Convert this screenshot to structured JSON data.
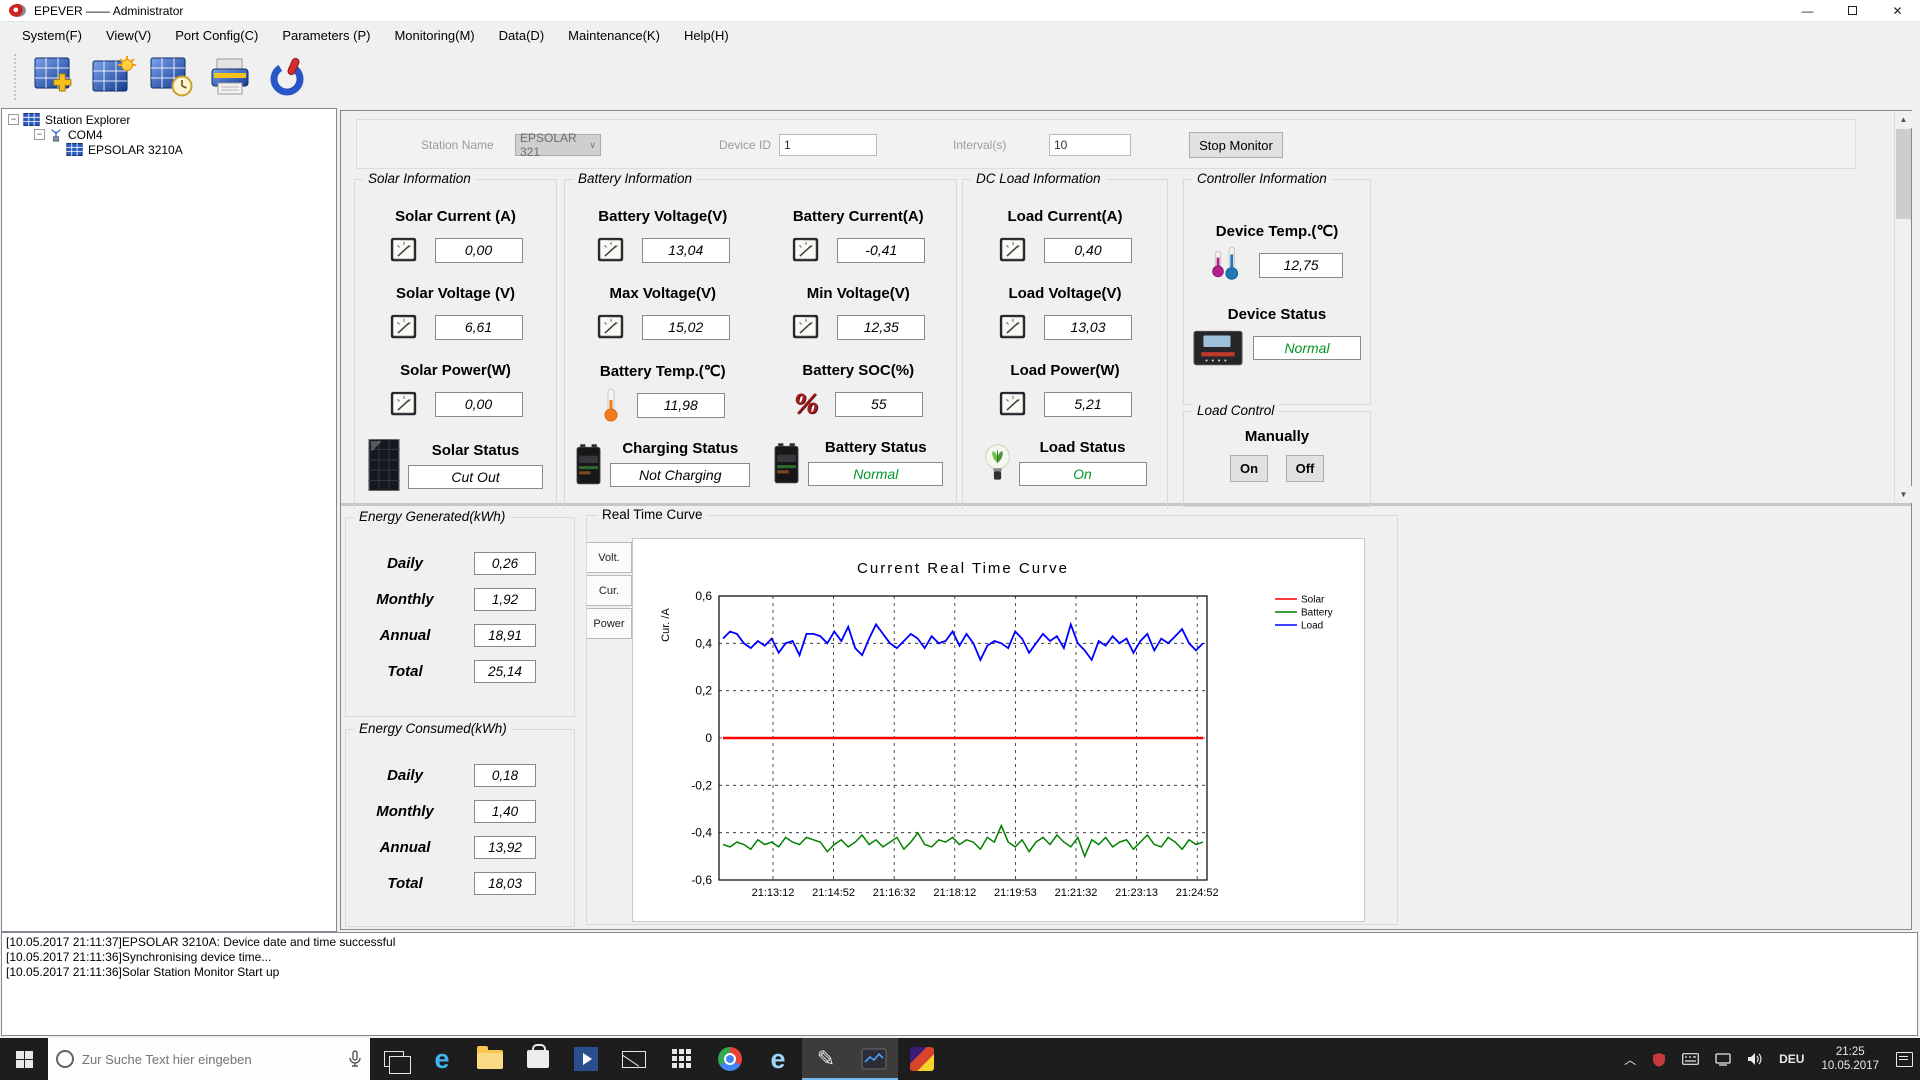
{
  "window": {
    "title": "EPEVER —— Administrator"
  },
  "menu": {
    "items": [
      "System(F)",
      "View(V)",
      "Port Config(C)",
      "Parameters (P)",
      "Monitoring(M)",
      "Data(D)",
      "Maintenance(K)",
      "Help(H)"
    ]
  },
  "toolbar": {
    "buttons": [
      "add-station",
      "station-monitor",
      "station-schedule",
      "print",
      "power"
    ]
  },
  "tree": {
    "root_label": "Station Explorer",
    "com_label": "COM4",
    "device_label": "EPSOLAR 3210A"
  },
  "station_bar": {
    "station_name_label": "Station Name",
    "station_name_value": "EPSOLAR 321",
    "device_id_label": "Device ID",
    "device_id_value": "1",
    "interval_label": "Interval(s)",
    "interval_value": "10",
    "stop_monitor_label": "Stop Monitor"
  },
  "solar": {
    "title": "Solar Information",
    "current_label": "Solar Current (A)",
    "current": "0,00",
    "voltage_label": "Solar Voltage (V)",
    "voltage": "6,61",
    "power_label": "Solar Power(W)",
    "power": "0,00",
    "status_label": "Solar Status",
    "status": "Cut Out"
  },
  "battery": {
    "title": "Battery Information",
    "voltage_label": "Battery Voltage(V)",
    "voltage": "13,04",
    "current_label": "Battery Current(A)",
    "current": "-0,41",
    "max_voltage_label": "Max Voltage(V)",
    "max_voltage": "15,02",
    "min_voltage_label": "Min Voltage(V)",
    "min_voltage": "12,35",
    "temp_label": "Battery Temp.(℃)",
    "temp": "11,98",
    "soc_label": "Battery SOC(%)",
    "soc": "55",
    "charging_status_label": "Charging Status",
    "charging_status": "Not Charging",
    "battery_status_label": "Battery Status",
    "battery_status": "Normal"
  },
  "load": {
    "title": "DC Load Information",
    "current_label": "Load Current(A)",
    "current": "0,40",
    "voltage_label": "Load Voltage(V)",
    "voltage": "13,03",
    "power_label": "Load Power(W)",
    "power": "5,21",
    "status_label": "Load Status",
    "status": "On"
  },
  "controller": {
    "title": "Controller Information",
    "temp_label": "Device Temp.(℃)",
    "temp": "12,75",
    "status_label": "Device Status",
    "status": "Normal"
  },
  "load_control": {
    "title": "Load Control",
    "manually_label": "Manually",
    "on_button": "On",
    "off_button": "Off"
  },
  "energy_generated": {
    "title": "Energy Generated(kWh)",
    "rows": [
      {
        "label": "Daily",
        "value": "0,26"
      },
      {
        "label": "Monthly",
        "value": "1,92"
      },
      {
        "label": "Annual",
        "value": "18,91"
      },
      {
        "label": "Total",
        "value": "25,14"
      }
    ]
  },
  "energy_consumed": {
    "title": "Energy Consumed(kWh)",
    "rows": [
      {
        "label": "Daily",
        "value": "0,18"
      },
      {
        "label": "Monthly",
        "value": "1,40"
      },
      {
        "label": "Annual",
        "value": "13,92"
      },
      {
        "label": "Total",
        "value": "18,03"
      }
    ]
  },
  "curve": {
    "group_title": "Real Time Curve",
    "tabs": [
      "Volt.",
      "Cur.",
      "Power"
    ]
  },
  "chart_data": {
    "type": "line",
    "title": "Current Real Time Curve",
    "xlabel": "",
    "ylabel": "Cur. /A",
    "ylim": [
      -0.6,
      0.6
    ],
    "grid": true,
    "legend_position": "right-top",
    "ytick_values": [
      0.6,
      0.4,
      0.2,
      0,
      -0.2,
      -0.4,
      -0.6
    ],
    "ytick_labels": [
      "0,6",
      "0,4",
      "0,2",
      "0",
      "-0,2",
      "-0,4",
      "-0,6"
    ],
    "x_labels": [
      "21:13:12",
      "21:14:52",
      "21:16:32",
      "21:18:12",
      "21:19:53",
      "21:21:32",
      "21:23:13",
      "21:24:52"
    ],
    "series": [
      {
        "name": "Solar",
        "color": "#ff0000",
        "values": [
          0,
          0,
          0,
          0,
          0,
          0,
          0,
          0,
          0,
          0,
          0,
          0,
          0,
          0,
          0,
          0,
          0,
          0,
          0,
          0,
          0,
          0,
          0,
          0,
          0,
          0,
          0,
          0,
          0,
          0,
          0,
          0,
          0,
          0,
          0,
          0,
          0,
          0,
          0,
          0,
          0,
          0,
          0,
          0,
          0,
          0,
          0,
          0,
          0,
          0,
          0,
          0,
          0,
          0,
          0,
          0,
          0,
          0,
          0,
          0,
          0,
          0,
          0,
          0,
          0,
          0,
          0,
          0,
          0,
          0
        ]
      },
      {
        "name": "Battery",
        "color": "#008000",
        "values": [
          -0.45,
          -0.46,
          -0.44,
          -0.45,
          -0.47,
          -0.43,
          -0.45,
          -0.44,
          -0.46,
          -0.42,
          -0.44,
          -0.45,
          -0.42,
          -0.43,
          -0.44,
          -0.48,
          -0.45,
          -0.43,
          -0.46,
          -0.44,
          -0.41,
          -0.45,
          -0.43,
          -0.46,
          -0.44,
          -0.42,
          -0.47,
          -0.44,
          -0.4,
          -0.45,
          -0.46,
          -0.43,
          -0.44,
          -0.42,
          -0.45,
          -0.43,
          -0.44,
          -0.47,
          -0.42,
          -0.44,
          -0.37,
          -0.44,
          -0.46,
          -0.43,
          -0.48,
          -0.44,
          -0.42,
          -0.45,
          -0.41,
          -0.44,
          -0.46,
          -0.42,
          -0.5,
          -0.43,
          -0.45,
          -0.42,
          -0.46,
          -0.44,
          -0.43,
          -0.47,
          -0.44,
          -0.41,
          -0.45,
          -0.46,
          -0.42,
          -0.44,
          -0.47,
          -0.43,
          -0.45,
          -0.44
        ]
      },
      {
        "name": "Load",
        "color": "#0000ff",
        "values": [
          0.42,
          0.45,
          0.44,
          0.4,
          0.38,
          0.41,
          0.39,
          0.42,
          0.36,
          0.4,
          0.41,
          0.35,
          0.44,
          0.44,
          0.43,
          0.4,
          0.45,
          0.41,
          0.47,
          0.38,
          0.35,
          0.42,
          0.48,
          0.44,
          0.4,
          0.38,
          0.41,
          0.44,
          0.42,
          0.38,
          0.43,
          0.4,
          0.41,
          0.45,
          0.39,
          0.44,
          0.4,
          0.33,
          0.39,
          0.41,
          0.4,
          0.38,
          0.45,
          0.42,
          0.36,
          0.4,
          0.44,
          0.41,
          0.43,
          0.38,
          0.48,
          0.4,
          0.37,
          0.33,
          0.41,
          0.39,
          0.43,
          0.4,
          0.42,
          0.36,
          0.41,
          0.44,
          0.37,
          0.42,
          0.4,
          0.43,
          0.46,
          0.4,
          0.37,
          0.4
        ]
      }
    ]
  },
  "log": {
    "lines": [
      "[10.05.2017 21:11:37]EPSOLAR 3210A: Device date and time successful",
      "[10.05.2017 21:11:36]Synchronising device time...",
      "[10.05.2017 21:11:36]Solar Station Monitor Start up"
    ]
  },
  "taskbar": {
    "search_placeholder": "Zur Suche Text hier eingeben",
    "language": "DEU",
    "time": "21:25",
    "date": "10.05.2017"
  },
  "colors": {
    "status_green": "#009624",
    "solar_series": "#ff0000",
    "battery_series": "#008000",
    "load_series": "#0000ff"
  }
}
